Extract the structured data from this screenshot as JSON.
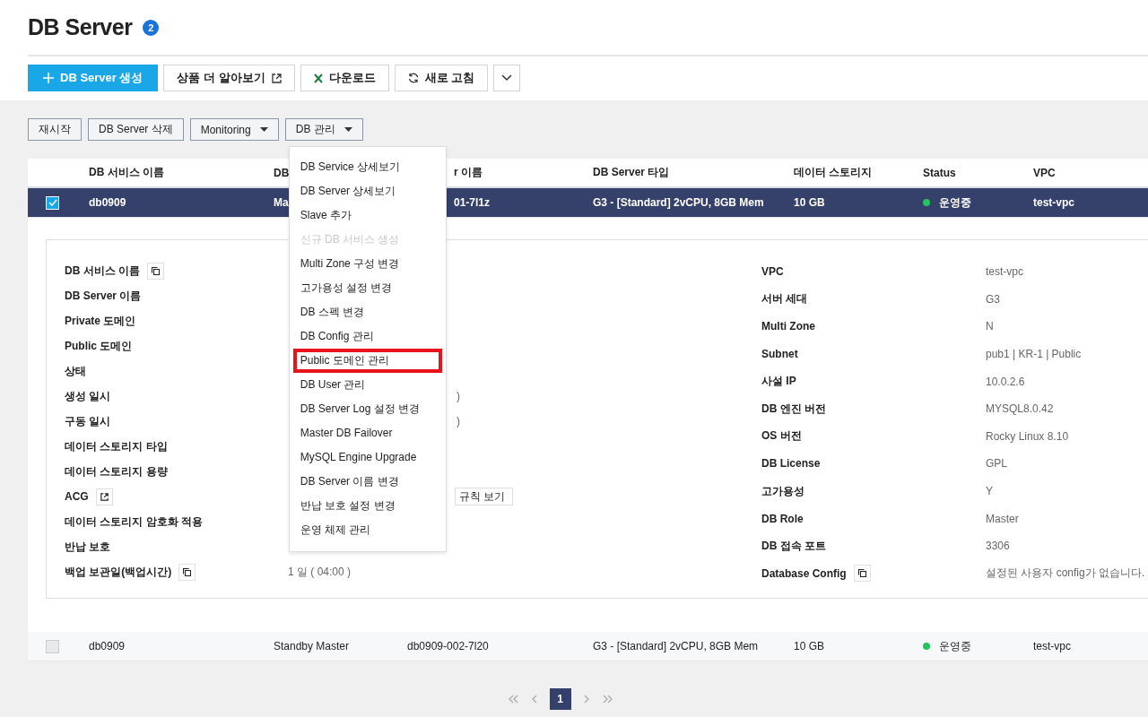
{
  "title": "DB Server",
  "count": "2",
  "toolbar": [
    {
      "kind": "primary",
      "label": "DB Server 생성"
    },
    {
      "kind": "external",
      "label": "상품 더 알아보기"
    },
    {
      "kind": "excel",
      "label": "다운로드"
    },
    {
      "kind": "refresh",
      "label": "새로 고침"
    },
    {
      "kind": "more"
    }
  ],
  "actions": [
    {
      "label": "재시작",
      "dropdown": false
    },
    {
      "label": "DB Server 삭제",
      "dropdown": false
    },
    {
      "label": "Monitoring",
      "dropdown": true
    },
    {
      "label": "DB 관리",
      "dropdown": true
    }
  ],
  "table": {
    "columns": [
      "DB 서비스 이름",
      "DB",
      "r 이름",
      "DB Server 타입",
      "데이터 스토리지",
      "Status",
      "VPC"
    ],
    "rows": [
      {
        "selected": true,
        "cells": [
          "db0909",
          "Ma",
          "01-7l1z",
          "G3 - [Standard] 2vCPU, 8GB Mem",
          "10 GB"
        ],
        "status": "운영중",
        "color": "#22c55e",
        "vpc": "test-vpc"
      },
      {
        "selected": false,
        "cells": [
          "db0909",
          "Standby Master",
          "db0909-002-7l20",
          "G3 - [Standard] 2vCPU, 8GB Mem",
          "10 GB"
        ],
        "status": "운영중",
        "color": "#22c55e",
        "vpc": "test-vpc"
      }
    ]
  },
  "detail": {
    "left": [
      {
        "label": "DB 서비스 이름",
        "kind": "copy"
      },
      {
        "label": "DB Server 이름"
      },
      {
        "label": "Private 도메인"
      },
      {
        "label": "Public 도메인"
      },
      {
        "label": "상태"
      },
      {
        "label": "생성 일시",
        "tail": ")"
      },
      {
        "label": "구동 일시",
        "tail": ")"
      },
      {
        "label": "데이터 스토리지 타입"
      },
      {
        "label": "데이터 스토리지 용량"
      },
      {
        "label": "ACG",
        "kind": "external",
        "tail_button": "규칙 보기"
      },
      {
        "label": "데이터 스토리지 암호화 적용"
      },
      {
        "label": "반납 보호"
      },
      {
        "label": "백업 보관일(백업시간)",
        "kind": "copy",
        "value": "1 일 ( 04:00 )"
      }
    ],
    "right": [
      {
        "label": "VPC",
        "value": "test-vpc"
      },
      {
        "label": "서버 세대",
        "value": "G3"
      },
      {
        "label": "Multi Zone",
        "value": "N"
      },
      {
        "label": "Subnet",
        "value": "pub1 | KR-1 | Public"
      },
      {
        "label": "사설 IP",
        "value": "10.0.2.6"
      },
      {
        "label": "DB 엔진 버전",
        "value": "MYSQL8.0.42"
      },
      {
        "label": "OS 버전",
        "value": "Rocky Linux 8.10"
      },
      {
        "label": "DB License",
        "value": "GPL"
      },
      {
        "label": "고가용성",
        "value": "Y"
      },
      {
        "label": "DB Role",
        "value": "Master"
      },
      {
        "label": "DB 접속 포트",
        "value": "3306"
      },
      {
        "label": "Database Config",
        "kind": "copy",
        "value": "설정된 사용자 config가 없습니다."
      }
    ]
  },
  "menu": [
    {
      "label": "DB Service 상세보기",
      "disabled": false,
      "highlighted": false
    },
    {
      "label": "DB Server 상세보기",
      "disabled": false,
      "highlighted": false
    },
    {
      "label": "Slave 추가",
      "disabled": false,
      "highlighted": false
    },
    {
      "label": "신규 DB 서비스 생성",
      "disabled": true,
      "highlighted": false
    },
    {
      "label": "Multi Zone 구성 변경",
      "disabled": false,
      "highlighted": false
    },
    {
      "label": "고가용성 설정 변경",
      "disabled": false,
      "highlighted": false
    },
    {
      "label": "DB 스펙 변경",
      "disabled": false,
      "highlighted": false
    },
    {
      "label": "DB Config 관리",
      "disabled": false,
      "highlighted": false
    },
    {
      "label": "Public 도메인 관리",
      "disabled": false,
      "highlighted": true
    },
    {
      "label": "DB User 관리",
      "disabled": false,
      "highlighted": false
    },
    {
      "label": "DB Server Log 설정 변경",
      "disabled": false,
      "highlighted": false
    },
    {
      "label": "Master DB Failover",
      "disabled": false,
      "highlighted": false
    },
    {
      "label": "MySQL Engine Upgrade",
      "disabled": false,
      "highlighted": false
    },
    {
      "label": "DB Server 이름 변경",
      "disabled": false,
      "highlighted": false
    },
    {
      "label": "반납 보호 설정 변경",
      "disabled": false,
      "highlighted": false
    },
    {
      "label": "운영 체제 관리",
      "disabled": false,
      "highlighted": false
    }
  ],
  "pagination": {
    "pages": [
      {
        "label": "1",
        "selected": true
      }
    ]
  }
}
